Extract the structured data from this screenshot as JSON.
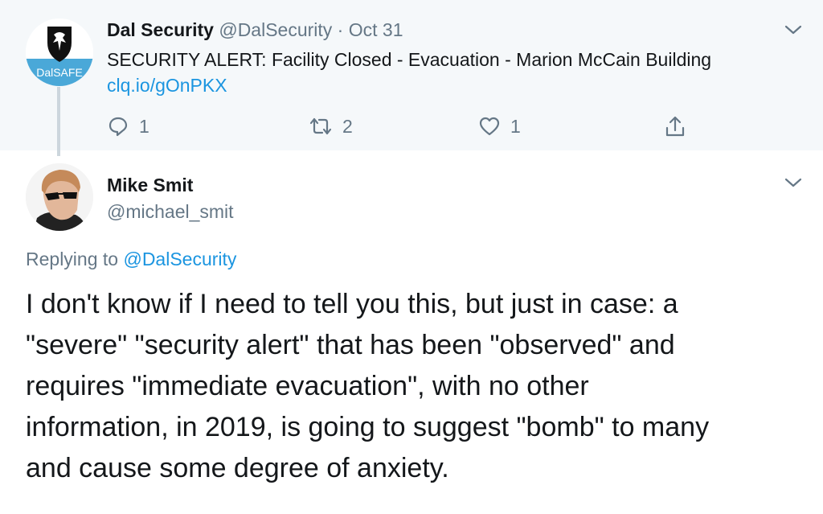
{
  "parent_tweet": {
    "avatar_badge_text": "DalSAFE",
    "display_name": "Dal Security",
    "handle": "@DalSecurity",
    "separator": " · ",
    "date": "Oct 31",
    "text": "SECURITY ALERT: Facility Closed - Evacuation - Marion McCain Building",
    "link": "clq.io/gOnPKX",
    "actions": {
      "reply_count": "1",
      "retweet_count": "2",
      "like_count": "1"
    },
    "icons": [
      "chevron-down-icon",
      "reply-icon",
      "retweet-icon",
      "like-icon",
      "share-icon"
    ]
  },
  "reply_tweet": {
    "display_name": "Mike Smit",
    "handle": "@michael_smit",
    "replying_prefix": "Replying to ",
    "replying_to": "@DalSecurity",
    "text": "I don't know if I need to tell you this, but just in case: a\n\"severe\" \"security alert\" that has been \"observed\" and\nrequires \"immediate evacuation\", with no other\ninformation, in 2019, is going to suggest \"bomb\" to many\nand cause some degree of anxiety."
  },
  "colors": {
    "link": "#1b95e0",
    "muted": "#657786",
    "parent_background": "#f5f8fa",
    "thread_line": "#ccd6dd",
    "badge_blue": "#4aa8d8"
  }
}
